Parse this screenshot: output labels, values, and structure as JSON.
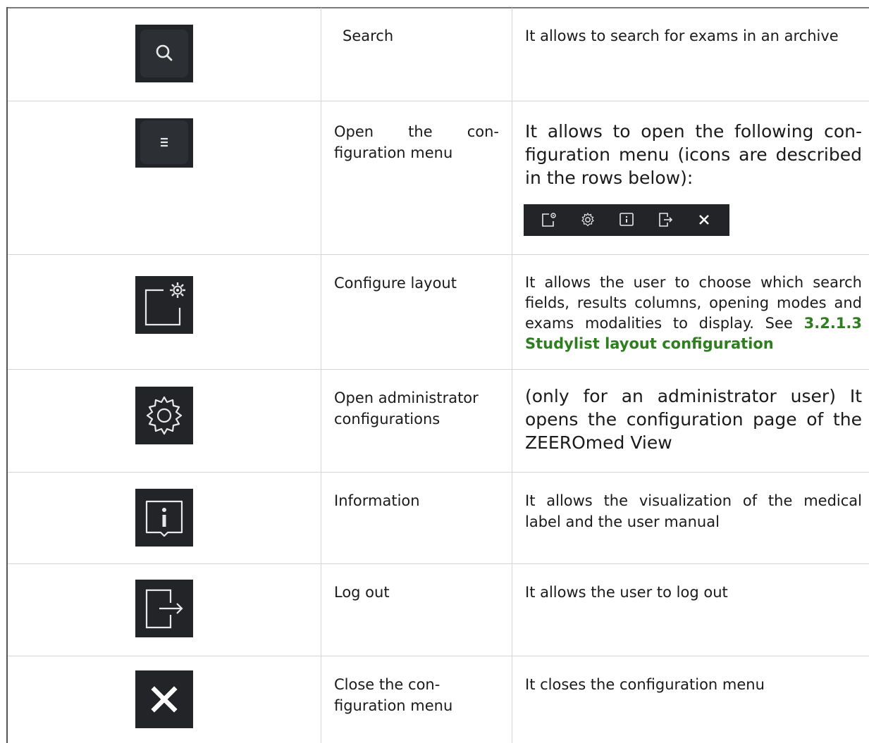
{
  "rows": [
    {
      "icon": "search-icon",
      "name": "Search",
      "description": "It allows to search for exams in an archive"
    },
    {
      "icon": "hamburger-menu-icon",
      "name": "Open the con-figuration menu",
      "description": "It allows to open the following con-figuration menu (icons are described in the rows below):",
      "menu_bar_icons": [
        "layout-config-icon",
        "gear-icon",
        "info-icon",
        "logout-icon",
        "close-icon"
      ]
    },
    {
      "icon": "layout-config-icon",
      "name": "Configure layout",
      "description": "It allows the user to choose which search fields, results columns, opening modes and exams modalities to display. See",
      "link": "3.2.1.3 Studylist layout configuration"
    },
    {
      "icon": "gear-icon",
      "name": "Open administrator configurations",
      "description": "(only for an administrator user) It opens the configuration page of the ZEEROmed View"
    },
    {
      "icon": "info-icon",
      "name": "Information",
      "description": "It allows the visualization of the medical label and the user manual"
    },
    {
      "icon": "logout-icon",
      "name": "Log out",
      "description": "It allows the user to log out"
    },
    {
      "icon": "close-icon",
      "name": "Close the con-figuration menu",
      "description": "It closes the configuration menu"
    }
  ],
  "colors": {
    "icon_background": "#222427",
    "icon_foreground": "#e8e8e8",
    "link": "#2e7d1f",
    "grid": "#d4d4d4"
  }
}
